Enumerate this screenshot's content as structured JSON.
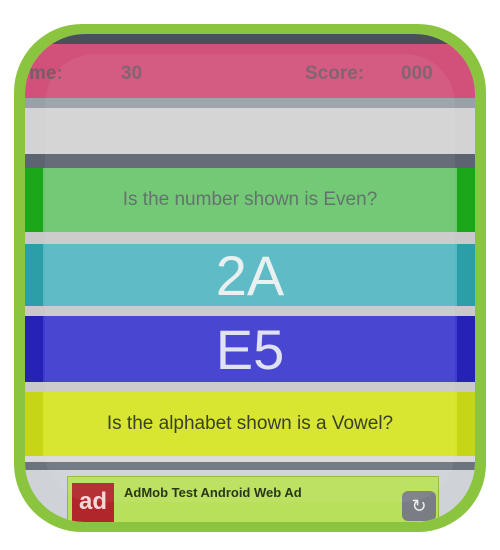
{
  "header": {
    "time_label": "me:",
    "time_value": "30",
    "score_label": "Score:",
    "score_value": "000"
  },
  "cards": {
    "even_question": "Is the number shown is Even?",
    "number_value": "2A",
    "letter_value": "E5",
    "vowel_question": "Is the alphabet shown is a Vowel?"
  },
  "ad": {
    "logo_text": "ad",
    "title": "AdMob Test Android Web Ad",
    "close_icon": "close-icon"
  },
  "colors": {
    "frame": "#8bc53f",
    "score_bar": "#d2517a",
    "even_card": "#6cc66e",
    "number_card": "#56b8c4",
    "letter_card": "#3e3cd0",
    "vowel_card": "#d6e526",
    "ad_bg": "#b8e05a"
  }
}
